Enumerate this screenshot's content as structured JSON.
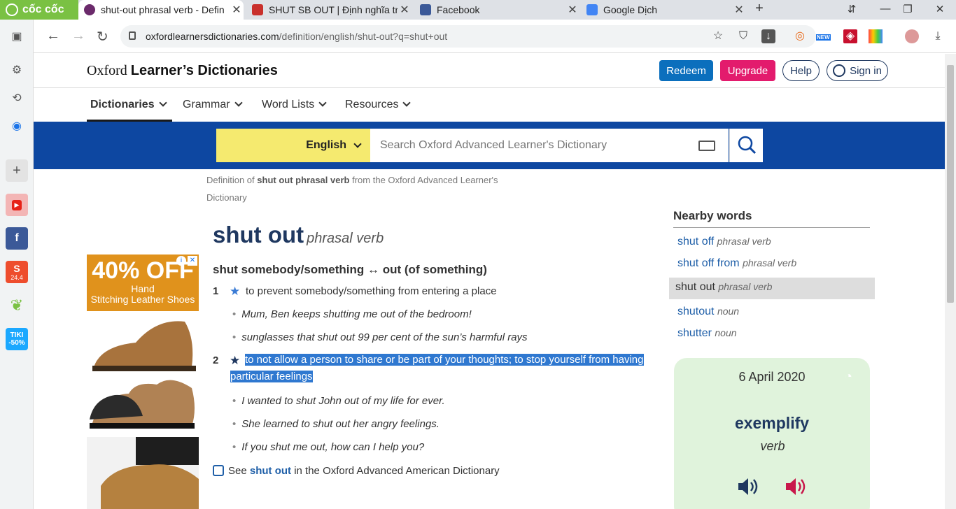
{
  "browser": {
    "brand_label": "cốc cốc",
    "tabs": [
      {
        "title": "shut-out phrasal verb - Defin",
        "favicon_color": "#6b2a6b",
        "active": true
      },
      {
        "title": "SHUT SB OUT | Định nghĩa trong",
        "favicon_color": "#c9302c"
      },
      {
        "title": "Facebook",
        "favicon_color": "#3b5998"
      },
      {
        "title": "Google Dịch",
        "favicon_color": "#4285f4"
      }
    ],
    "url": {
      "host": "oxfordlearnersdictionaries.com",
      "path": "/definition/english/shut-out?q=shut+out"
    },
    "toolbar_badge": "NEW"
  },
  "sidebar": {
    "shopee_badge": "24.4",
    "tiki_label": "TIKI",
    "tiki_badge": "-50%"
  },
  "site": {
    "brand_light": "Oxford",
    "brand_bold": "Learner’s Dictionaries",
    "header_buttons": {
      "redeem": "Redeem",
      "upgrade": "Upgrade",
      "help": "Help",
      "signin": "Sign in"
    },
    "nav": [
      "Dictionaries",
      "Grammar",
      "Word Lists",
      "Resources"
    ],
    "search": {
      "language": "English",
      "placeholder": "Search Oxford Advanced Learner's Dictionary"
    },
    "colors": {
      "nav_blue": "#0d47a1",
      "redeem": "#0b6fbd",
      "upgrade": "#e31b6d",
      "lang_yellow": "#f5ea6f",
      "highlight": "#2f78d0"
    }
  },
  "entry": {
    "definition_of": {
      "prefix": "Definition of",
      "term": "shut out phrasal verb",
      "suffix": "from the Oxford Advanced Learner's Dictionary"
    },
    "headword": "shut out",
    "pos": "phrasal verb",
    "phrasal": "shut somebody/something ↔ out (of something)",
    "senses": [
      {
        "num": "1",
        "definition": "to prevent somebody/something from entering a place",
        "examples": [
          "Mum, Ben keeps shutting me out of the bedroom!",
          "sunglasses that shut out 99 per cent of the sun’s harmful rays"
        ]
      },
      {
        "num": "2",
        "definition_line1": "to not allow a person to share or be part of your thoughts; to stop yourself from having",
        "definition_line2": "particular feelings",
        "examples": [
          "I wanted to shut John out of my life for ever.",
          "She learned to shut out her angry feelings.",
          "If you shut me out, how can I help you?"
        ]
      }
    ],
    "see_also": {
      "prefix": "See",
      "term": "shut out",
      "suffix": "in the Oxford Advanced American Dictionary"
    }
  },
  "ad": {
    "headline": "40% OFF",
    "line1": "Hand",
    "line2": "Stitching Leather Shoes"
  },
  "nearby": {
    "title": "Nearby words",
    "items": [
      {
        "word": "shut off",
        "pos": "phrasal verb"
      },
      {
        "word": "shut off from",
        "pos": "phrasal verb"
      },
      {
        "word": "shut out",
        "pos": "phrasal verb",
        "current": true
      },
      {
        "word": "shutout",
        "pos": "noun"
      },
      {
        "word": "shutter",
        "pos": "noun"
      }
    ]
  },
  "word_of_day": {
    "date": "6 April 2020",
    "word": "exemplify",
    "pos": "verb"
  }
}
